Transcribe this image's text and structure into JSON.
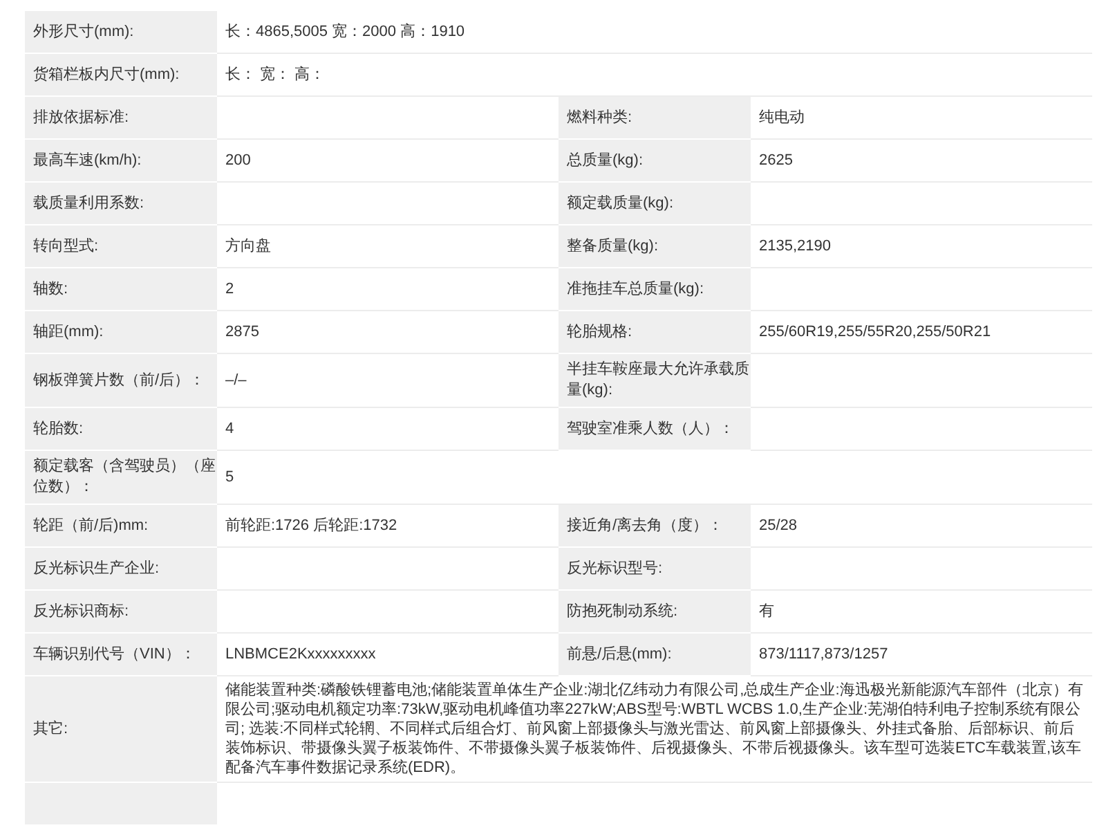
{
  "rows": [
    {
      "label": "外形尺寸(mm):",
      "value": "长：4865,5005 宽：2000 高：1910"
    },
    {
      "label": "货箱栏板内尺寸(mm):",
      "value": "长：  宽：  高："
    },
    {
      "label": "排放依据标准:",
      "label2": "燃料种类:",
      "value2": "纯电动"
    },
    {
      "label": "最高车速(km/h):",
      "value": "200",
      "label2": "总质量(kg):",
      "value2": "2625"
    },
    {
      "label": "载质量利用系数:",
      "label2": "额定载质量(kg):"
    },
    {
      "label": "转向型式:",
      "value": "方向盘",
      "label2": "整备质量(kg):",
      "value2": "2135,2190"
    },
    {
      "label": "轴数:",
      "value": "2",
      "label2": "准拖挂车总质量(kg):"
    },
    {
      "label": "轴距(mm):",
      "value": "2875",
      "label2": "轮胎规格:",
      "value2": "255/60R19,255/55R20,255/50R21"
    },
    {
      "label": "钢板弹簧片数（前/后）：",
      "value": "–/–",
      "label2": "半挂车鞍座最大允许承载质量(kg):"
    },
    {
      "label": "轮胎数:",
      "value": "4",
      "label2": "驾驶室准乘人数（人）："
    },
    {
      "label": "额定载客（含驾驶员）（座位数）：",
      "value": "5"
    },
    {
      "label": "轮距（前/后)mm:",
      "value": "前轮距:1726 后轮距:1732",
      "label2": "接近角/离去角（度）：",
      "value2": "25/28"
    },
    {
      "label": "反光标识生产企业:",
      "label2": "反光标识型号:"
    },
    {
      "label": "反光标识商标:",
      "label2": "防抱死制动系统:",
      "value2": "有"
    },
    {
      "label": "车辆识别代号（VIN）：",
      "value": "LNBMCE2Kxxxxxxxxx",
      "label2": "前悬/后悬(mm):",
      "value2": "873/1117,873/1257"
    },
    {
      "label": "其它:",
      "value": "储能装置种类:磷酸铁锂蓄电池;储能装置单体生产企业:湖北亿纬动力有限公司,总成生产企业:海迅极光新能源汽车部件（北京）有限公司;驱动电机额定功率:73kW,驱动电机峰值功率227kW;ABS型号:WBTL WCBS 1.0,生产企业:芜湖伯特利电子控制系统有限公司; 选装:不同样式轮辋、不同样式后组合灯、前风窗上部摄像头与激光雷达、前风窗上部摄像头、外挂式备胎、后部标识、前后装饰标识、带摄像头翼子板装饰件、不带摄像头翼子板装饰件、后视摄像头、不带后视摄像头。该车型可选装ETC车载装置,该车配备汽车事件数据记录系统(EDR)。"
    }
  ]
}
